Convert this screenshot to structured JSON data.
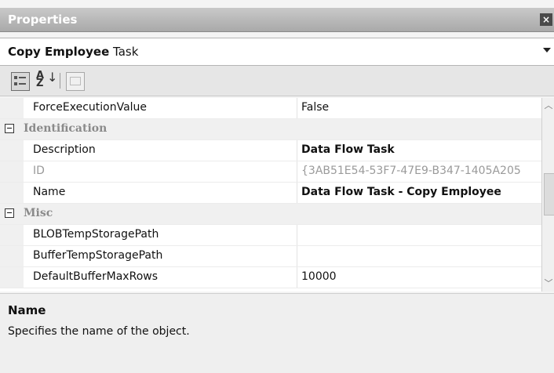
{
  "window": {
    "title": "Properties",
    "close_glyph": "×"
  },
  "object_selector": {
    "name": "Copy Employee",
    "type": "Task"
  },
  "toolbar": {
    "alphabetical_glyph": "A\nZ",
    "arrow_glyph": "↓"
  },
  "grid": {
    "rows": [
      {
        "kind": "property",
        "name": "ForceExecutionValue",
        "value": "False"
      },
      {
        "kind": "category",
        "name": "Identification"
      },
      {
        "kind": "property",
        "name": "Description",
        "value": "Data Flow Task",
        "bold": true
      },
      {
        "kind": "property",
        "name": "ID",
        "value": "{3AB51E54-53F7-47E9-B347-1405A205",
        "dim": true
      },
      {
        "kind": "property",
        "name": "Name",
        "value": "Data Flow Task - Copy Employee",
        "bold": true
      },
      {
        "kind": "category",
        "name": "Misc"
      },
      {
        "kind": "property",
        "name": "BLOBTempStoragePath",
        "value": ""
      },
      {
        "kind": "property",
        "name": "BufferTempStoragePath",
        "value": ""
      },
      {
        "kind": "property",
        "name": "DefaultBufferMaxRows",
        "value": "10000"
      }
    ]
  },
  "scrollbar": {
    "up_glyph": "︿",
    "down_glyph": "﹀"
  },
  "description": {
    "title": "Name",
    "text": "Specifies the name of the object."
  }
}
